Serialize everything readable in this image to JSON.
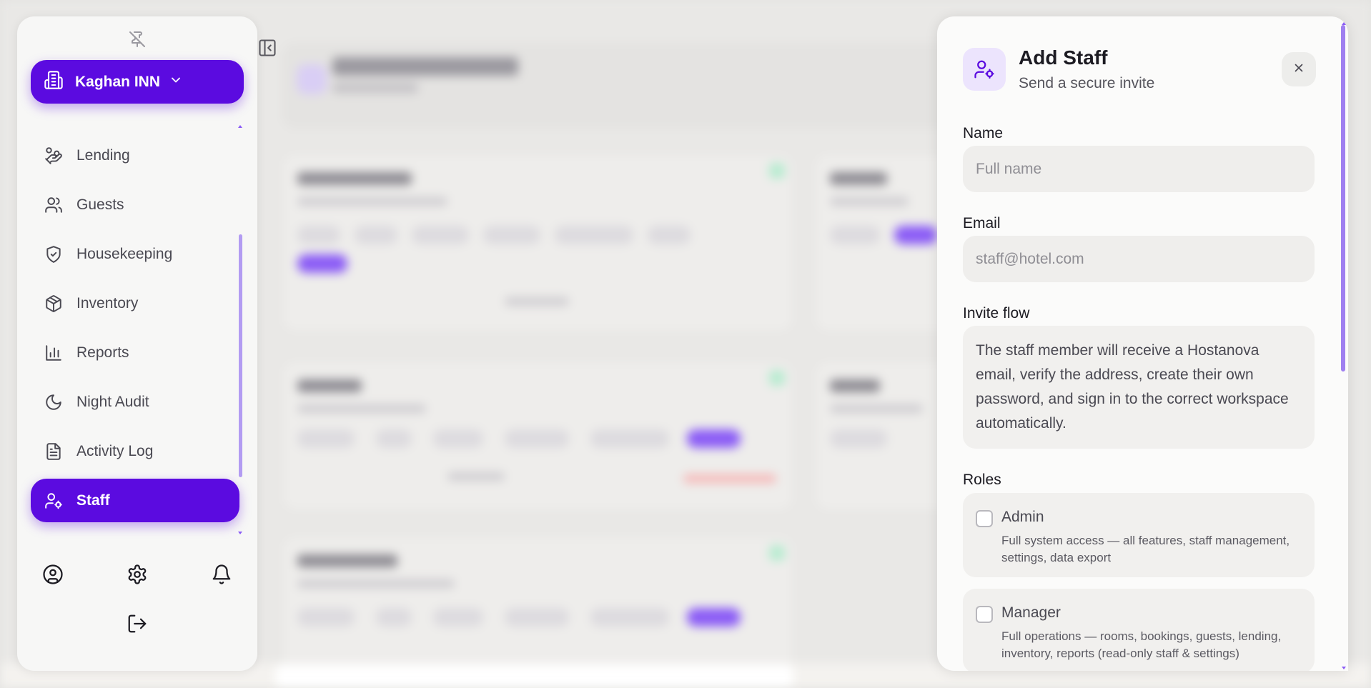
{
  "sidebar": {
    "hotel_name": "Kaghan INN",
    "items": [
      {
        "label": "Lending",
        "icon": "hand-coins-icon"
      },
      {
        "label": "Guests",
        "icon": "users-icon"
      },
      {
        "label": "Housekeeping",
        "icon": "shield-icon"
      },
      {
        "label": "Inventory",
        "icon": "package-icon"
      },
      {
        "label": "Reports",
        "icon": "bar-chart-icon"
      },
      {
        "label": "Night Audit",
        "icon": "moon-icon"
      },
      {
        "label": "Activity Log",
        "icon": "document-icon"
      },
      {
        "label": "Staff",
        "icon": "user-cog-icon",
        "active": true
      }
    ],
    "footer_icons": [
      "profile-icon",
      "settings-icon",
      "bell-icon",
      "logout-icon"
    ]
  },
  "modal": {
    "title": "Add Staff",
    "subtitle": "Send a secure invite",
    "name_label": "Name",
    "name_placeholder": "Full name",
    "email_label": "Email",
    "email_placeholder": "staff@hotel.com",
    "invite_label": "Invite flow",
    "invite_text": "The staff member will receive a Hostanova email, verify the address, create their own password, and sign in to the correct workspace automatically.",
    "roles_label": "Roles",
    "roles": [
      {
        "name": "Admin",
        "description": "Full system access — all features, staff management, settings, data export",
        "checked": false
      },
      {
        "name": "Manager",
        "description": "Full operations — rooms, bookings, guests, lending, inventory, reports (read-only staff & settings)",
        "checked": false
      }
    ]
  },
  "colors": {
    "accent": "#5b0be0",
    "accent_soft": "#ece4fd"
  }
}
